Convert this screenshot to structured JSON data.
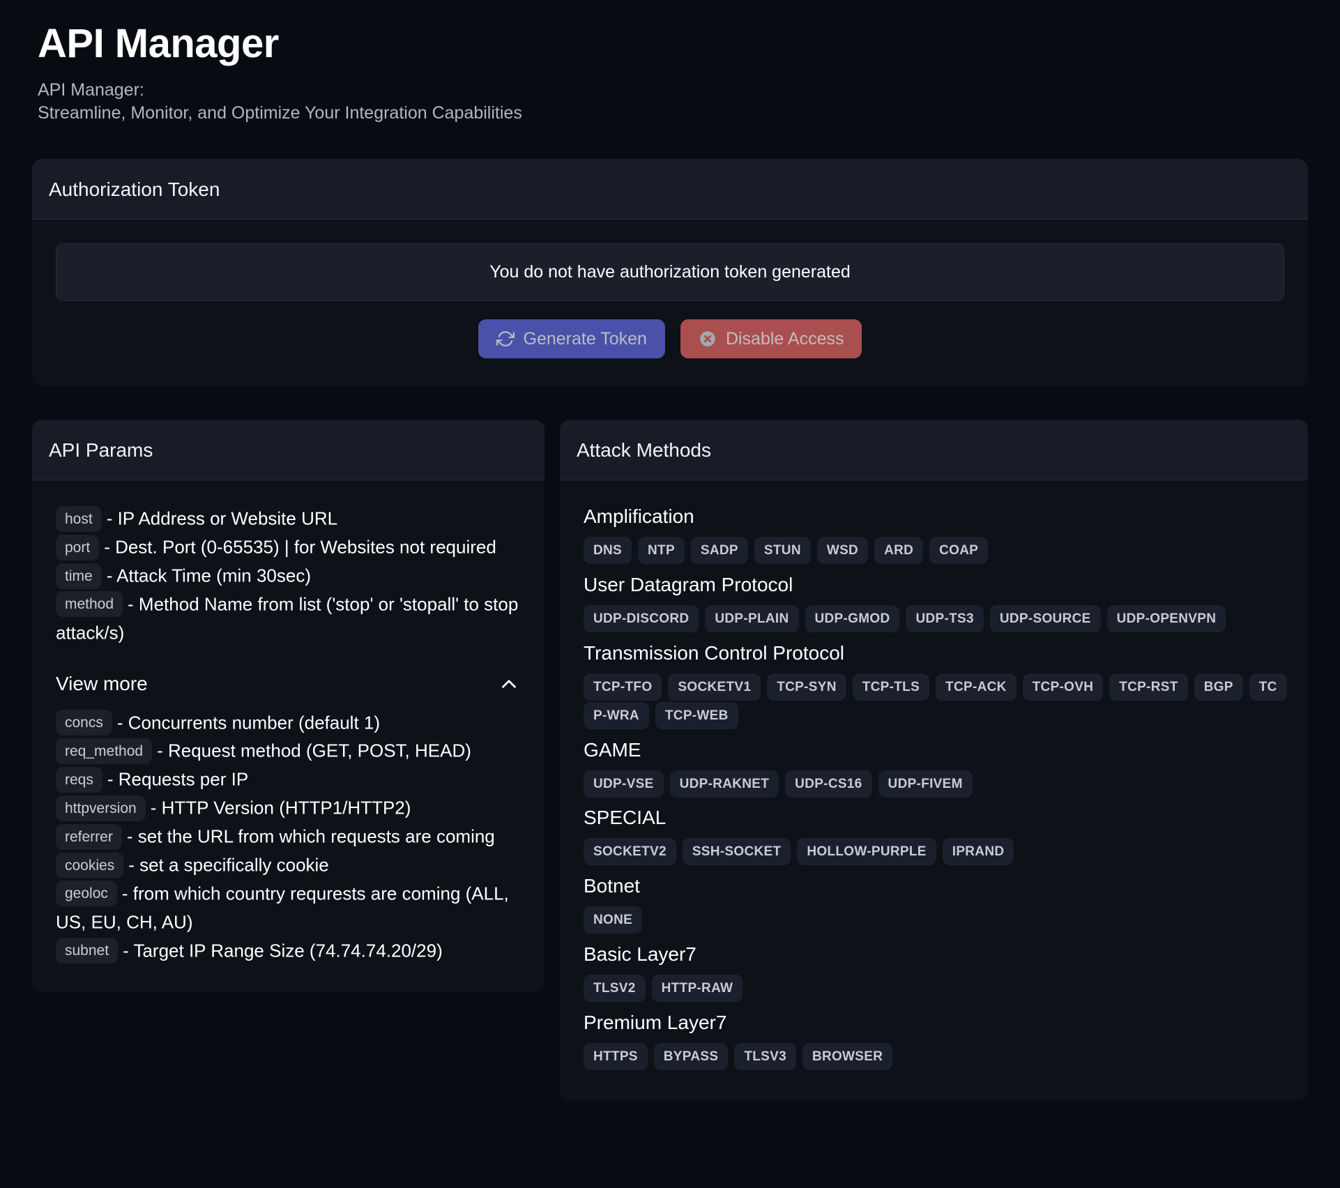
{
  "header": {
    "title": "API Manager",
    "subtitle_line1": "API Manager:",
    "subtitle_line2": "Streamline, Monitor, and Optimize Your Integration Capabilities"
  },
  "auth": {
    "card_title": "Authorization Token",
    "message": "You do not have authorization token generated",
    "generate_label": "Generate Token",
    "disable_label": "Disable Access",
    "generate_icon": "refresh-icon",
    "disable_icon": "circle-x-icon",
    "generate_color": "#4a51a8",
    "disable_color": "#a94f4f"
  },
  "api_params": {
    "card_title": "API Params",
    "base": [
      {
        "name": "host",
        "desc": "- IP Address or Website URL"
      },
      {
        "name": "port",
        "desc": "- Dest. Port (0-65535) | for Websites not required"
      },
      {
        "name": "time",
        "desc": "- Attack Time (min 30sec)"
      },
      {
        "name": "method",
        "desc": "- Method Name from list ('stop' or 'stopall' to stop attack/s)"
      }
    ],
    "view_more_label": "View more",
    "view_more_icon": "chevron-up-icon",
    "expanded": true,
    "more": [
      {
        "name": "concs",
        "desc": "- Concurrents number (default 1)"
      },
      {
        "name": "req_method",
        "desc": "- Request method (GET, POST, HEAD)"
      },
      {
        "name": "reqs",
        "desc": "- Requests per IP"
      },
      {
        "name": "httpversion",
        "desc": "- HTTP Version (HTTP1/HTTP2)"
      },
      {
        "name": "referrer",
        "desc": "- set the URL from which requests are coming"
      },
      {
        "name": "cookies",
        "desc": "- set a specifically cookie"
      },
      {
        "name": "geoloc",
        "desc": "- from which country requrests are coming (ALL, US, EU, CH, AU)"
      },
      {
        "name": "subnet",
        "desc": "- Target IP Range Size (74.74.74.20/29)"
      }
    ]
  },
  "attack_methods": {
    "card_title": "Attack Methods",
    "groups": [
      {
        "title": "Amplification",
        "tags": [
          "DNS",
          "NTP",
          "SADP",
          "STUN",
          "WSD",
          "ARD",
          "COAP"
        ]
      },
      {
        "title": "User Datagram Protocol",
        "tags": [
          "UDP-DISCORD",
          "UDP-PLAIN",
          "UDP-GMOD",
          "UDP-TS3",
          "UDP-SOURCE",
          "UDP-OPENVPN"
        ]
      },
      {
        "title": "Transmission Control Protocol",
        "tags": [
          "TCP-TFO",
          "SOCKETV1",
          "TCP-SYN",
          "TCP-TLS",
          "TCP-ACK",
          "TCP-OVH",
          "TCP-RST",
          "BGP",
          "TCP-WRA",
          "TCP-WEB"
        ]
      },
      {
        "title": "GAME",
        "tags": [
          "UDP-VSE",
          "UDP-RAKNET",
          "UDP-CS16",
          "UDP-FIVEM"
        ]
      },
      {
        "title": "SPECIAL",
        "tags": [
          "SOCKETV2",
          "SSH-SOCKET",
          "HOLLOW-PURPLE",
          "IPRAND"
        ]
      },
      {
        "title": "Botnet",
        "tags": [
          "NONE"
        ]
      },
      {
        "title": "Basic Layer7",
        "tags": [
          "TLSV2",
          "HTTP-RAW"
        ]
      },
      {
        "title": "Premium Layer7",
        "tags": [
          "HTTPS",
          "BYPASS",
          "TLSV3",
          "BROWSER"
        ]
      }
    ]
  }
}
